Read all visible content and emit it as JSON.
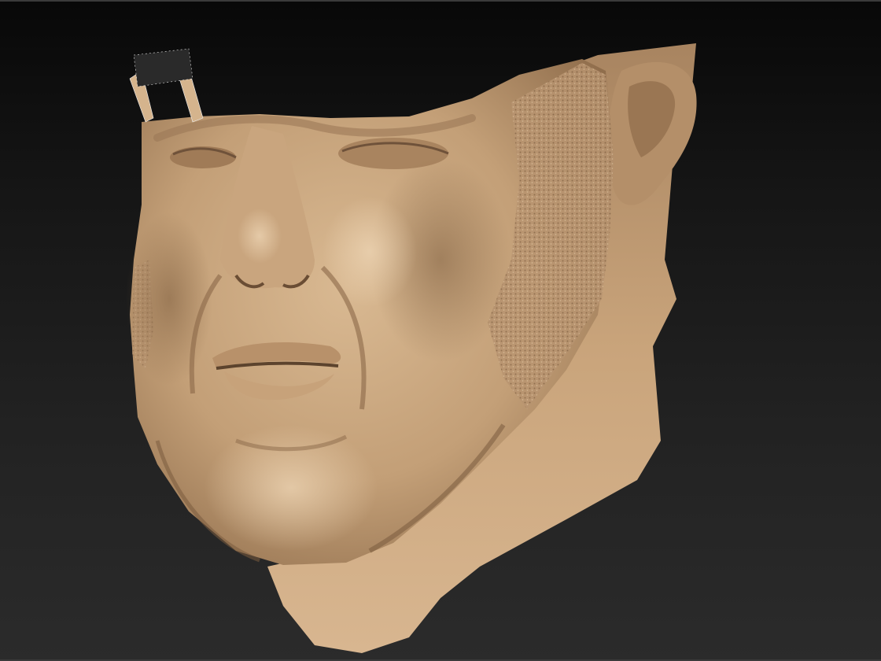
{
  "viewport": {
    "background_top": "#080808",
    "background_bottom": "#2b2b2b"
  },
  "model": {
    "subject": "sculpted-head",
    "material_color": "#c8a47c",
    "material_shadow": "#8e6c4a",
    "material_highlight": "#e3c7a4"
  }
}
